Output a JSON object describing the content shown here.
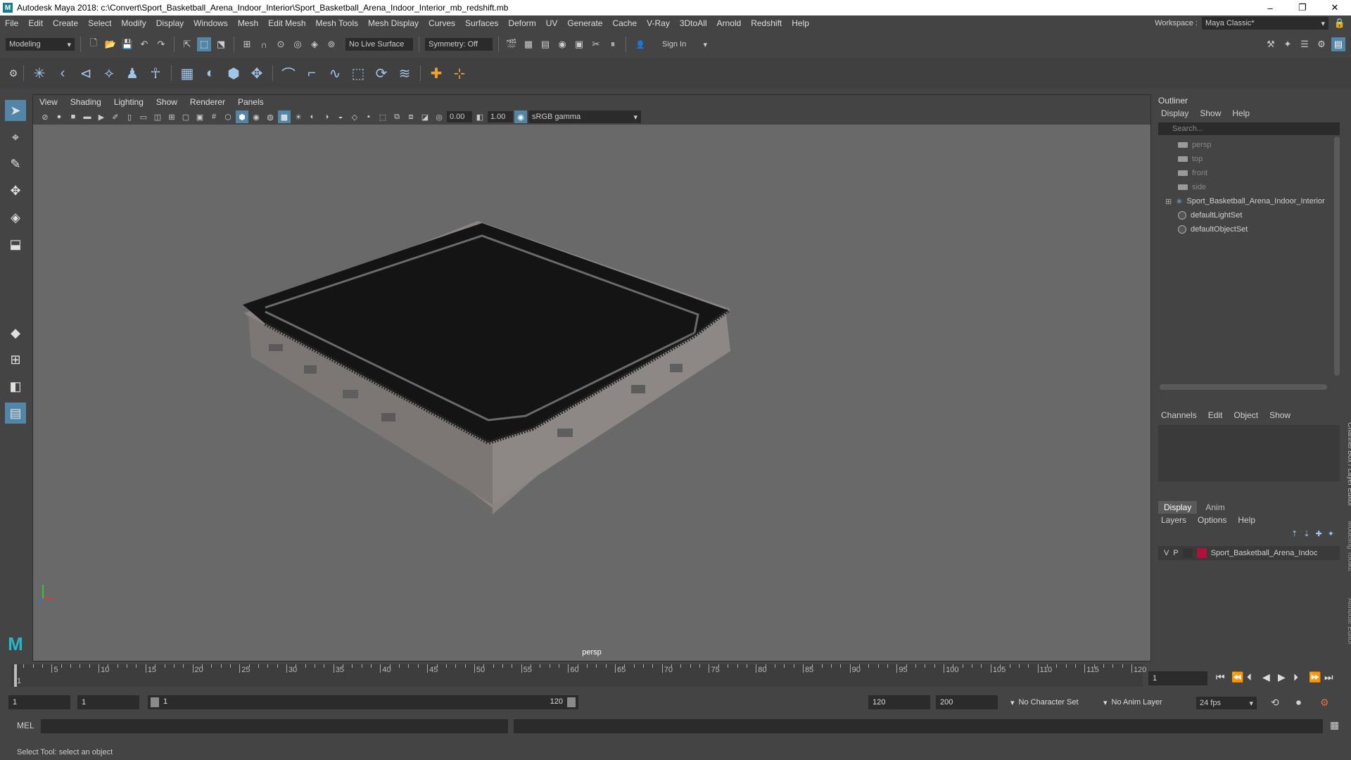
{
  "window": {
    "title": "Autodesk Maya 2018: c:\\Convert\\Sport_Basketball_Arena_Indoor_Interior\\Sport_Basketball_Arena_Indoor_Interior_mb_redshift.mb",
    "minimize": "–",
    "maximize": "❐",
    "close": "✕"
  },
  "menubar": {
    "items": [
      "File",
      "Edit",
      "Create",
      "Select",
      "Modify",
      "Display",
      "Windows",
      "Mesh",
      "Edit Mesh",
      "Mesh Tools",
      "Mesh Display",
      "Curves",
      "Surfaces",
      "Deform",
      "UV",
      "Generate",
      "Cache",
      "V-Ray",
      "3DtoAll",
      "Arnold",
      "Redshift",
      "Help"
    ],
    "workspace_label": "Workspace :",
    "workspace_value": "Maya Classic*"
  },
  "statusline": {
    "mode": "Modeling",
    "live_surface": "No Live Surface",
    "symmetry": "Symmetry: Off",
    "sign_in": "Sign In"
  },
  "viewport": {
    "menu": [
      "View",
      "Shading",
      "Lighting",
      "Show",
      "Renderer",
      "Panels"
    ],
    "exposure": "0.00",
    "gamma": "1.00",
    "color_space": "sRGB gamma",
    "camera_label": "persp"
  },
  "outliner": {
    "title": "Outliner",
    "menu": [
      "Display",
      "Show",
      "Help"
    ],
    "search_placeholder": "Search...",
    "items": [
      {
        "label": "persp",
        "type": "camera"
      },
      {
        "label": "top",
        "type": "camera"
      },
      {
        "label": "front",
        "type": "camera"
      },
      {
        "label": "side",
        "type": "camera"
      },
      {
        "label": "Sport_Basketball_Arena_Indoor_Interior",
        "type": "group"
      },
      {
        "label": "defaultLightSet",
        "type": "set"
      },
      {
        "label": "defaultObjectSet",
        "type": "set"
      }
    ]
  },
  "channelbox": {
    "menu": [
      "Channels",
      "Edit",
      "Object",
      "Show"
    ],
    "side_label": "Channel Box / Layer Editor"
  },
  "layers": {
    "tabs": [
      "Display",
      "Anim"
    ],
    "menu": [
      "Layers",
      "Options",
      "Help"
    ],
    "row": {
      "v": "V",
      "p": "P",
      "name": "Sport_Basketball_Arena_Indoc"
    },
    "color": "#b0103a"
  },
  "side_tabs": [
    "Modeling Toolkit",
    "Attribute Editor"
  ],
  "timeline": {
    "ticks": [
      5,
      10,
      15,
      20,
      25,
      30,
      35,
      40,
      45,
      50,
      55,
      60,
      65,
      70,
      75,
      80,
      85,
      90,
      95,
      100,
      105,
      110,
      115,
      120
    ],
    "start_label": "1",
    "current_frame": "1"
  },
  "range": {
    "start": "1",
    "playback_start": "1",
    "slider_start": "1",
    "slider_end": "120",
    "playback_end": "120",
    "end": "200",
    "character_set": "No Character Set",
    "anim_layer": "No Anim Layer",
    "fps": "24 fps"
  },
  "cmdline": {
    "label": "MEL"
  },
  "helpline": {
    "text": "Select Tool: select an object"
  }
}
